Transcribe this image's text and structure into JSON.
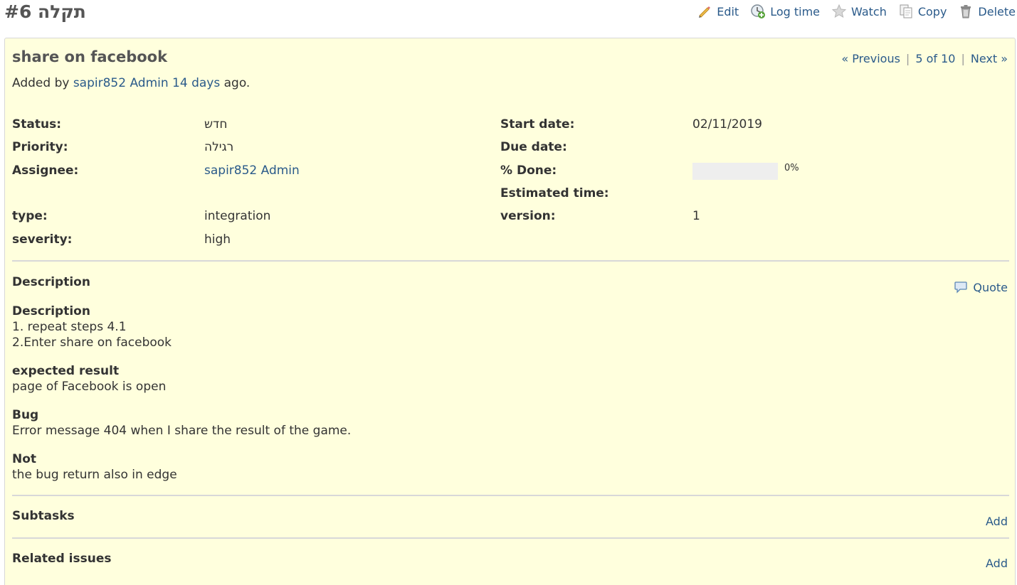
{
  "header": {
    "title": "תקלה #6",
    "actions": [
      {
        "label": "Edit",
        "icon": "pencil-icon"
      },
      {
        "label": "Log time",
        "icon": "clock-add-icon"
      },
      {
        "label": "Watch",
        "icon": "star-icon"
      },
      {
        "label": "Copy",
        "icon": "copy-icon"
      },
      {
        "label": "Delete",
        "icon": "trash-icon"
      }
    ]
  },
  "issue": {
    "subject": "share on facebook",
    "author": {
      "prefix": "Added by",
      "user": "sapir852 Admin",
      "age": "14 days",
      "suffix": "ago."
    },
    "nav": {
      "previous": "« Previous",
      "position": "5 of 10",
      "next": "Next »"
    },
    "attributes": {
      "status": {
        "label": "Status:",
        "value": "חדש"
      },
      "priority": {
        "label": "Priority:",
        "value": "רגילה"
      },
      "assignee": {
        "label": "Assignee:",
        "value": "sapir852 Admin"
      },
      "type": {
        "label": "type:",
        "value": "integration"
      },
      "severity": {
        "label": "severity:",
        "value": "high"
      },
      "start_date": {
        "label": "Start date:",
        "value": "02/11/2019"
      },
      "due_date": {
        "label": "Due date:",
        "value": ""
      },
      "done": {
        "label": "% Done:",
        "value": "0%",
        "fraction": 0
      },
      "estimated": {
        "label": "Estimated time:",
        "value": ""
      },
      "version": {
        "label": "version:",
        "value": "1"
      }
    },
    "description": {
      "title": "Description",
      "quote_label": "Quote",
      "blocks": [
        {
          "heading": "Description",
          "lines": [
            "1. repeat steps 4.1",
            "2.Enter share on facebook"
          ]
        },
        {
          "heading": "expected result",
          "lines": [
            "page of Facebook is open"
          ]
        },
        {
          "heading": "Bug",
          "lines": [
            "Error message 404 when I share the result of the game."
          ]
        },
        {
          "heading": "Not",
          "lines": [
            "the bug return also in edge"
          ]
        }
      ]
    },
    "subtasks": {
      "title": "Subtasks",
      "add_label": "Add"
    },
    "relations": {
      "title": "Related issues",
      "add_label": "Add"
    }
  },
  "colors": {
    "link": "#2a5a8a",
    "issue_background": "#ffffdd",
    "title": "#555555"
  }
}
